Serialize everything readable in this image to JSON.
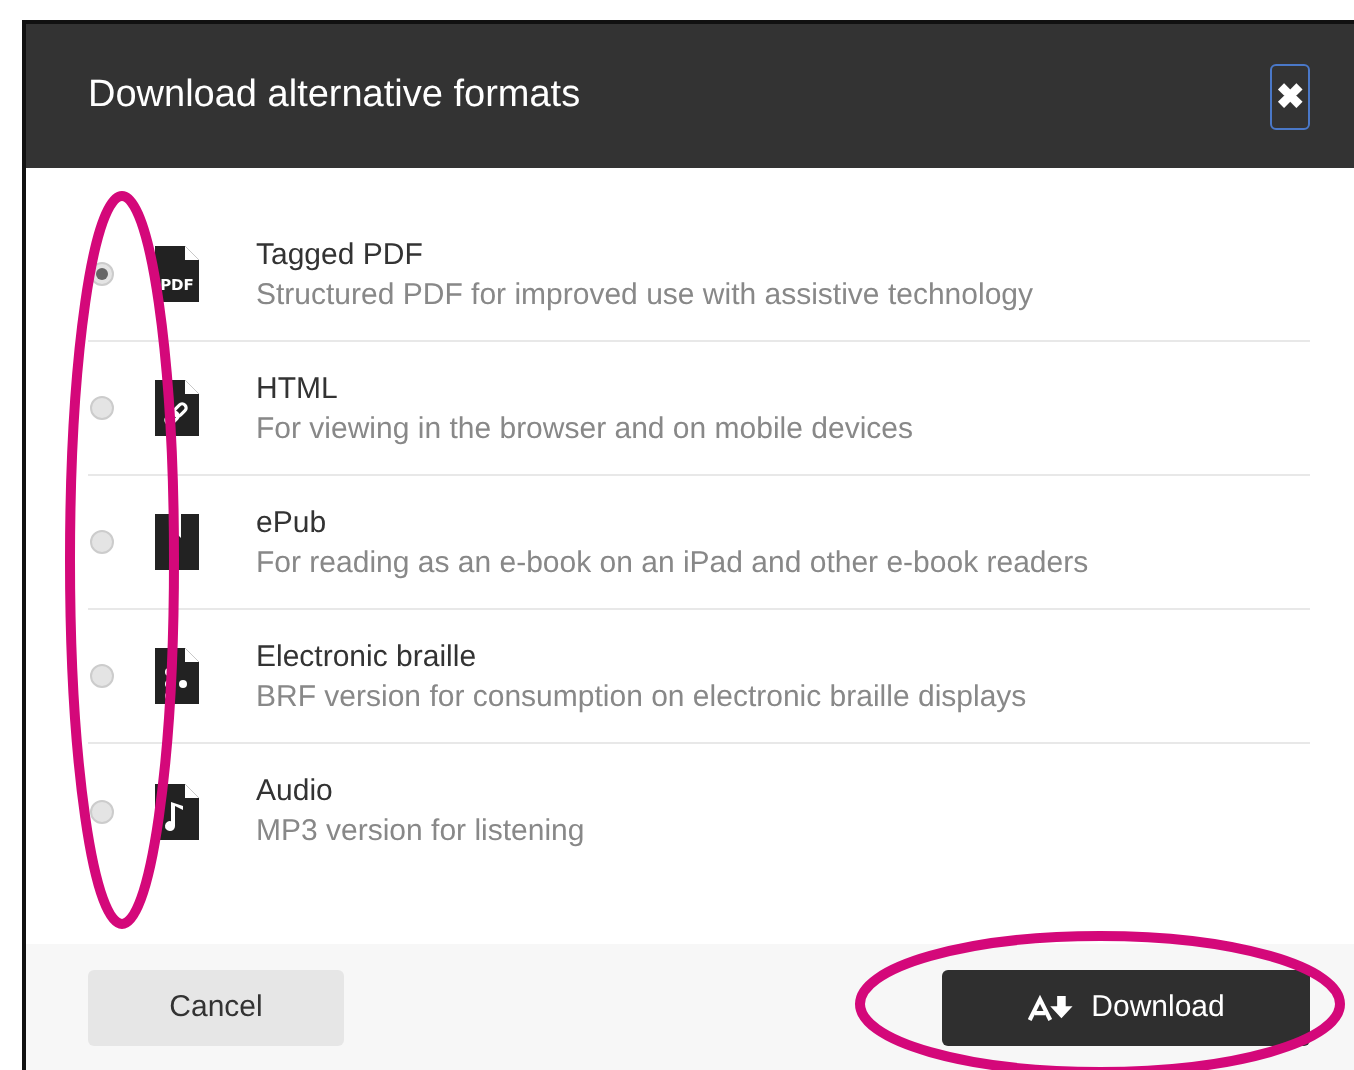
{
  "dialog": {
    "title": "Download alternative formats",
    "close_label": "✖"
  },
  "formats": [
    {
      "kind": "pdf",
      "icon_text": "PDF",
      "name": "Tagged PDF",
      "description": "Structured PDF for improved use with assistive technology",
      "selected": true
    },
    {
      "kind": "link",
      "name": "HTML",
      "description": "For viewing in the browser and on mobile devices",
      "selected": false
    },
    {
      "kind": "book",
      "name": "ePub",
      "description": "For reading as an e-book on an iPad and other e-book readers",
      "selected": false
    },
    {
      "kind": "braille",
      "name": "Electronic braille",
      "description": "BRF version for consumption on electronic braille displays",
      "selected": false
    },
    {
      "kind": "audio",
      "name": "Audio",
      "description": "MP3 version for listening",
      "selected": false
    }
  ],
  "buttons": {
    "cancel": "Cancel",
    "download": "Download"
  }
}
